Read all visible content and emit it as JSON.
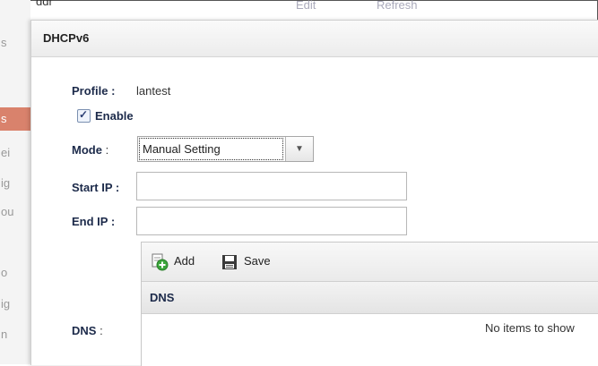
{
  "dialog": {
    "title": "DHCPv6"
  },
  "background": {
    "top_text": "ddr",
    "top_edit": "Edit",
    "top_refresh": "Refresh",
    "left_letters": [
      "s",
      "s",
      "ei",
      "ig",
      "ou",
      "o",
      "ig",
      "n"
    ]
  },
  "form": {
    "profile_label": "Profile :",
    "profile_value": "lantest",
    "enable_label": "Enable",
    "enable_checked": true,
    "mode_label": "Mode",
    "mode_colon": ":",
    "mode_value": "Manual Setting",
    "start_ip_label": "Start IP :",
    "start_ip_value": "",
    "end_ip_label": "End IP :",
    "end_ip_value": "",
    "dns_label": "DNS",
    "dns_colon": ":"
  },
  "dns_grid": {
    "add_label": "Add",
    "save_label": "Save",
    "column_header": "DNS",
    "empty_text": "No items to show"
  },
  "colors": {
    "label": "#1c2a4a",
    "accent_red": "#d9826c",
    "add_icon": "#3aa63a"
  }
}
